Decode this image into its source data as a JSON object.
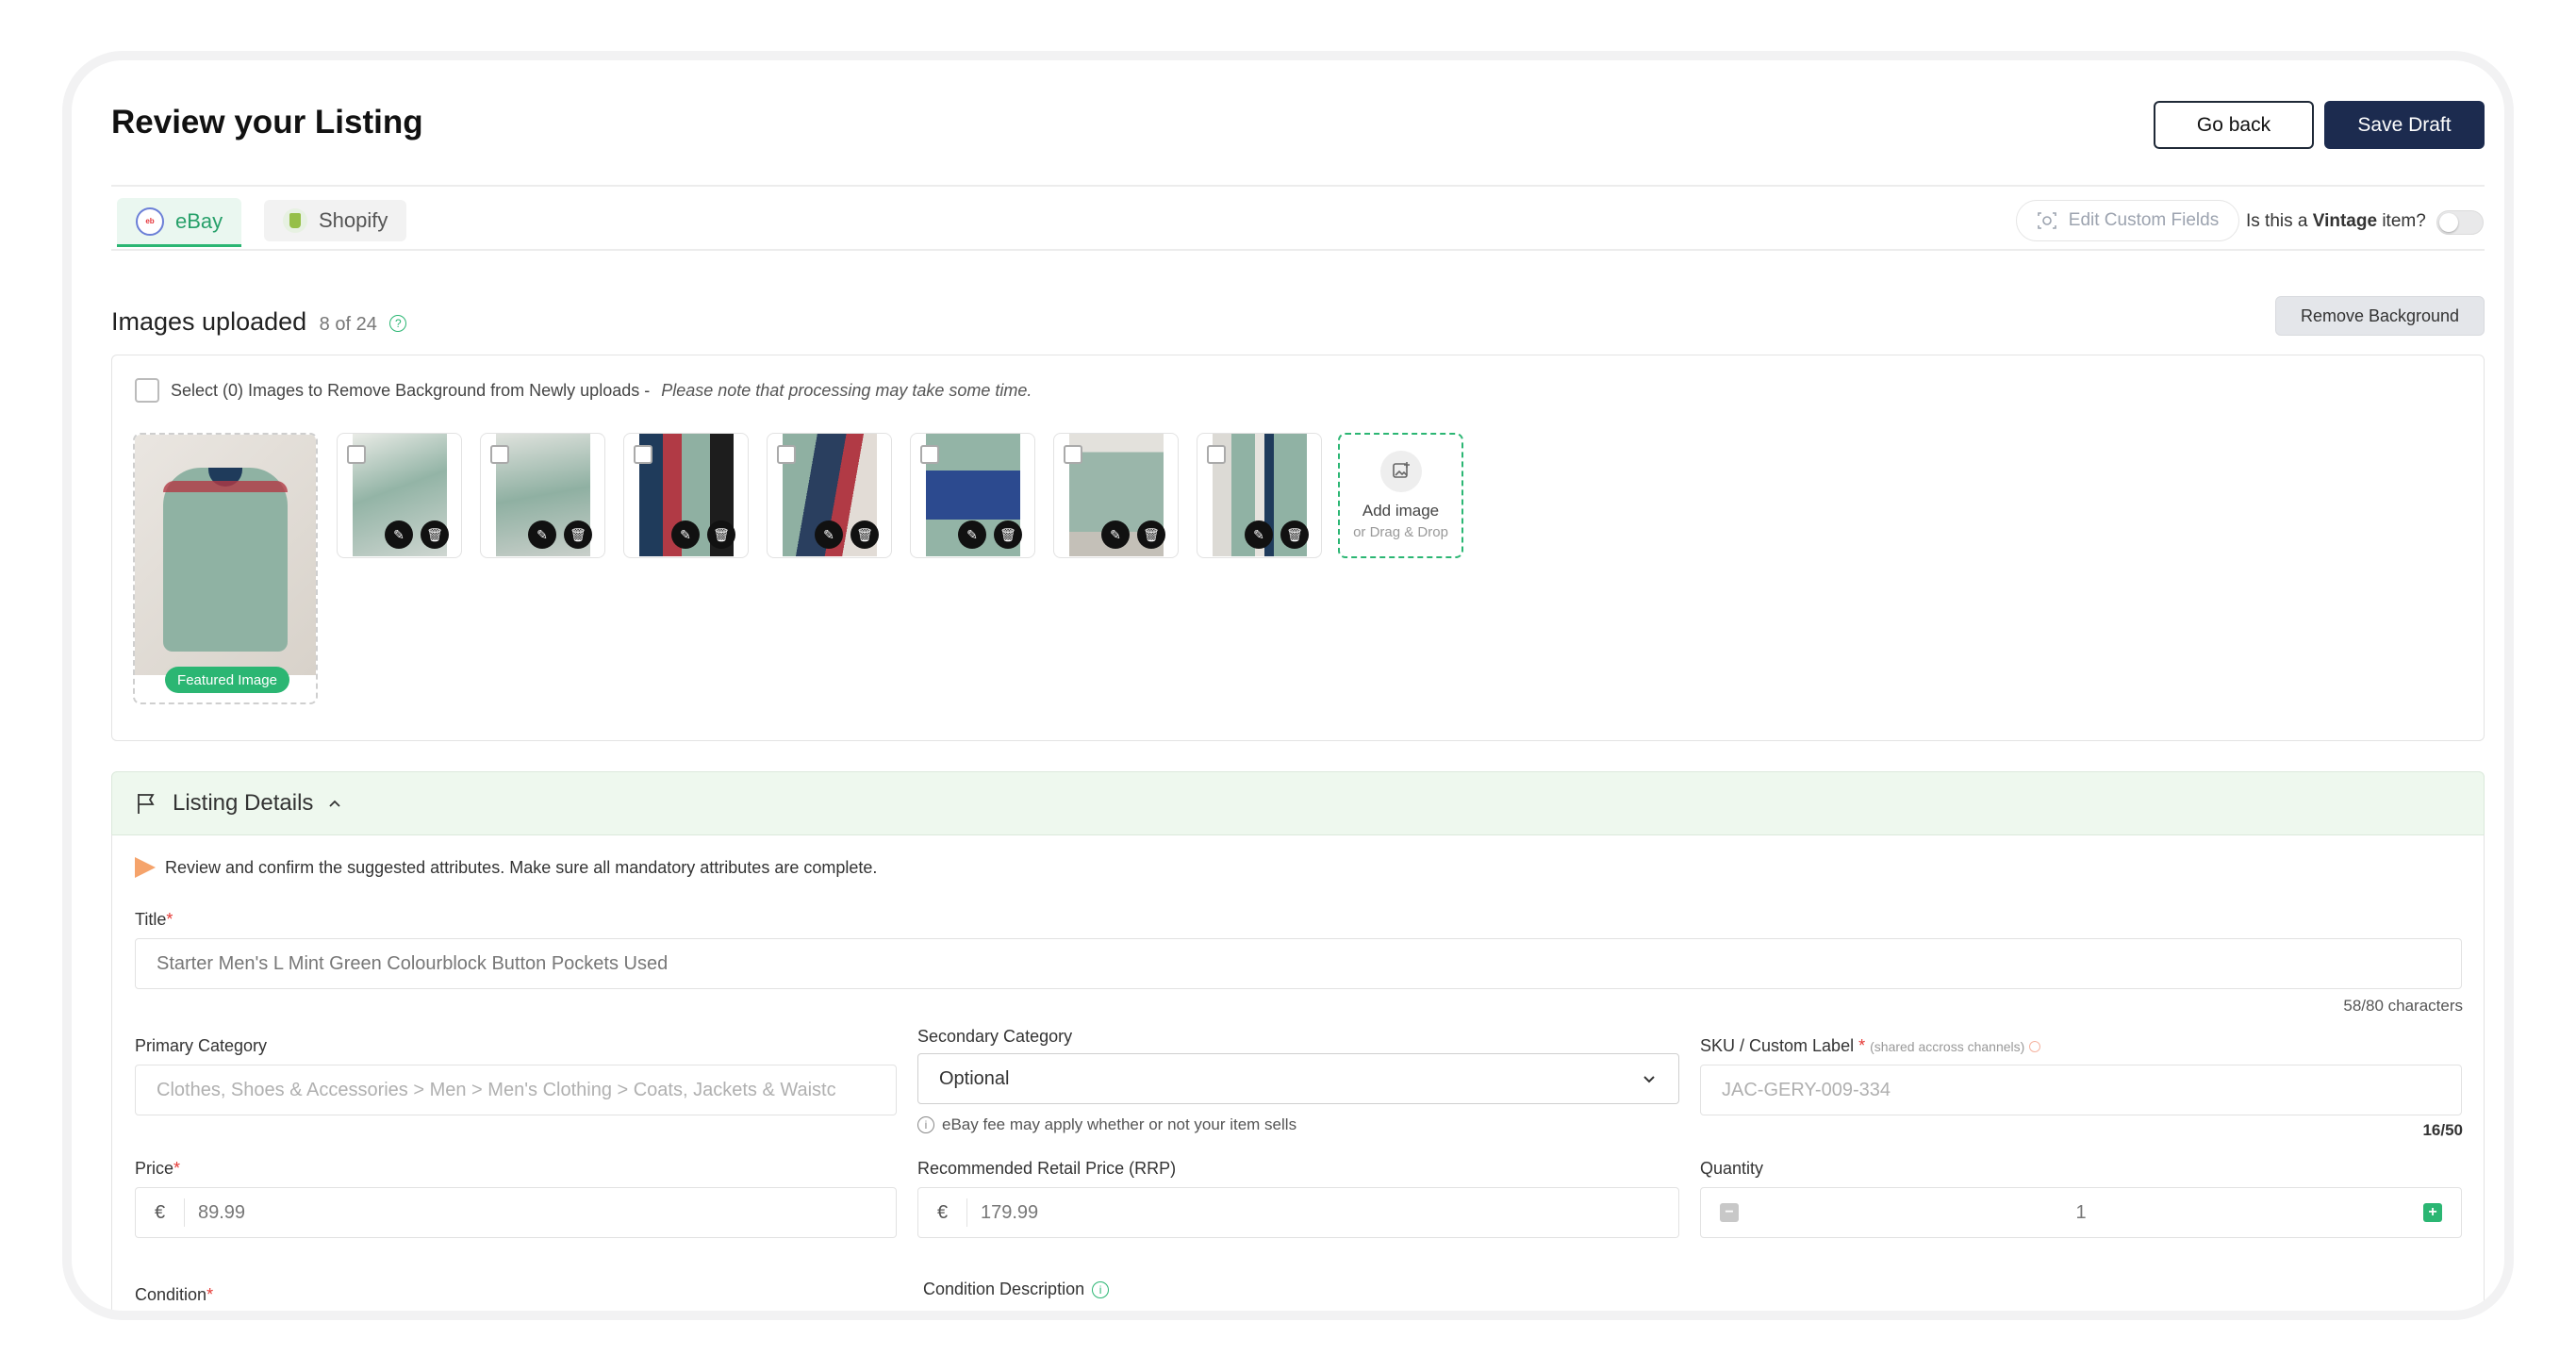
{
  "header": {
    "title": "Review your Listing",
    "go_back_label": "Go back",
    "save_draft_label": "Save Draft"
  },
  "tabs": [
    {
      "label": "eBay",
      "active": true
    },
    {
      "label": "Shopify",
      "active": false
    }
  ],
  "toolbar": {
    "edit_custom_fields_label": "Edit Custom Fields",
    "vintage_prefix": "Is this a",
    "vintage_bold": "Vintage",
    "vintage_suffix": "item?",
    "vintage_on": false
  },
  "images": {
    "title": "Images uploaded",
    "count": "8 of 24",
    "remove_bg_label": "Remove Background",
    "select_text": "Select (0) Images to Remove Background from Newly uploads -",
    "select_note": "Please note that processing may take some time.",
    "featured_badge": "Featured Image",
    "thumbnails": 7,
    "add_image_label": "Add image",
    "add_image_hint": "or Drag & Drop"
  },
  "listing": {
    "section_title": "Listing Details",
    "notice": "Review and confirm the suggested attributes. Make sure all mandatory attributes are complete.",
    "title_label": "Title",
    "title_value": "Starter Men's L Mint Green Colourblock Button Pockets Used",
    "title_count": "58/80 characters",
    "primary_category_label": "Primary Category",
    "primary_category_value": "Clothes, Shoes & Accessories > Men > Men's Clothing > Coats, Jackets & Waistc",
    "secondary_category_label": "Secondary Category",
    "secondary_category_value": "Optional",
    "secondary_hint": "eBay fee may apply whether or not your item sells",
    "sku_label": "SKU / Custom Label",
    "sku_note": "(shared accross channels)",
    "sku_value": "JAC-GERY-009-334",
    "sku_count": "16/50",
    "price_label": "Price",
    "currency": "€",
    "price_value": "89.99",
    "rrp_label": "Recommended Retail Price (RRP)",
    "rrp_value": "179.99",
    "quantity_label": "Quantity",
    "quantity_value": "1",
    "condition_label": "Condition",
    "condition_desc_label": "Condition Description"
  },
  "colors": {
    "accent": "#2bb673",
    "primary": "#1c2b4f"
  }
}
